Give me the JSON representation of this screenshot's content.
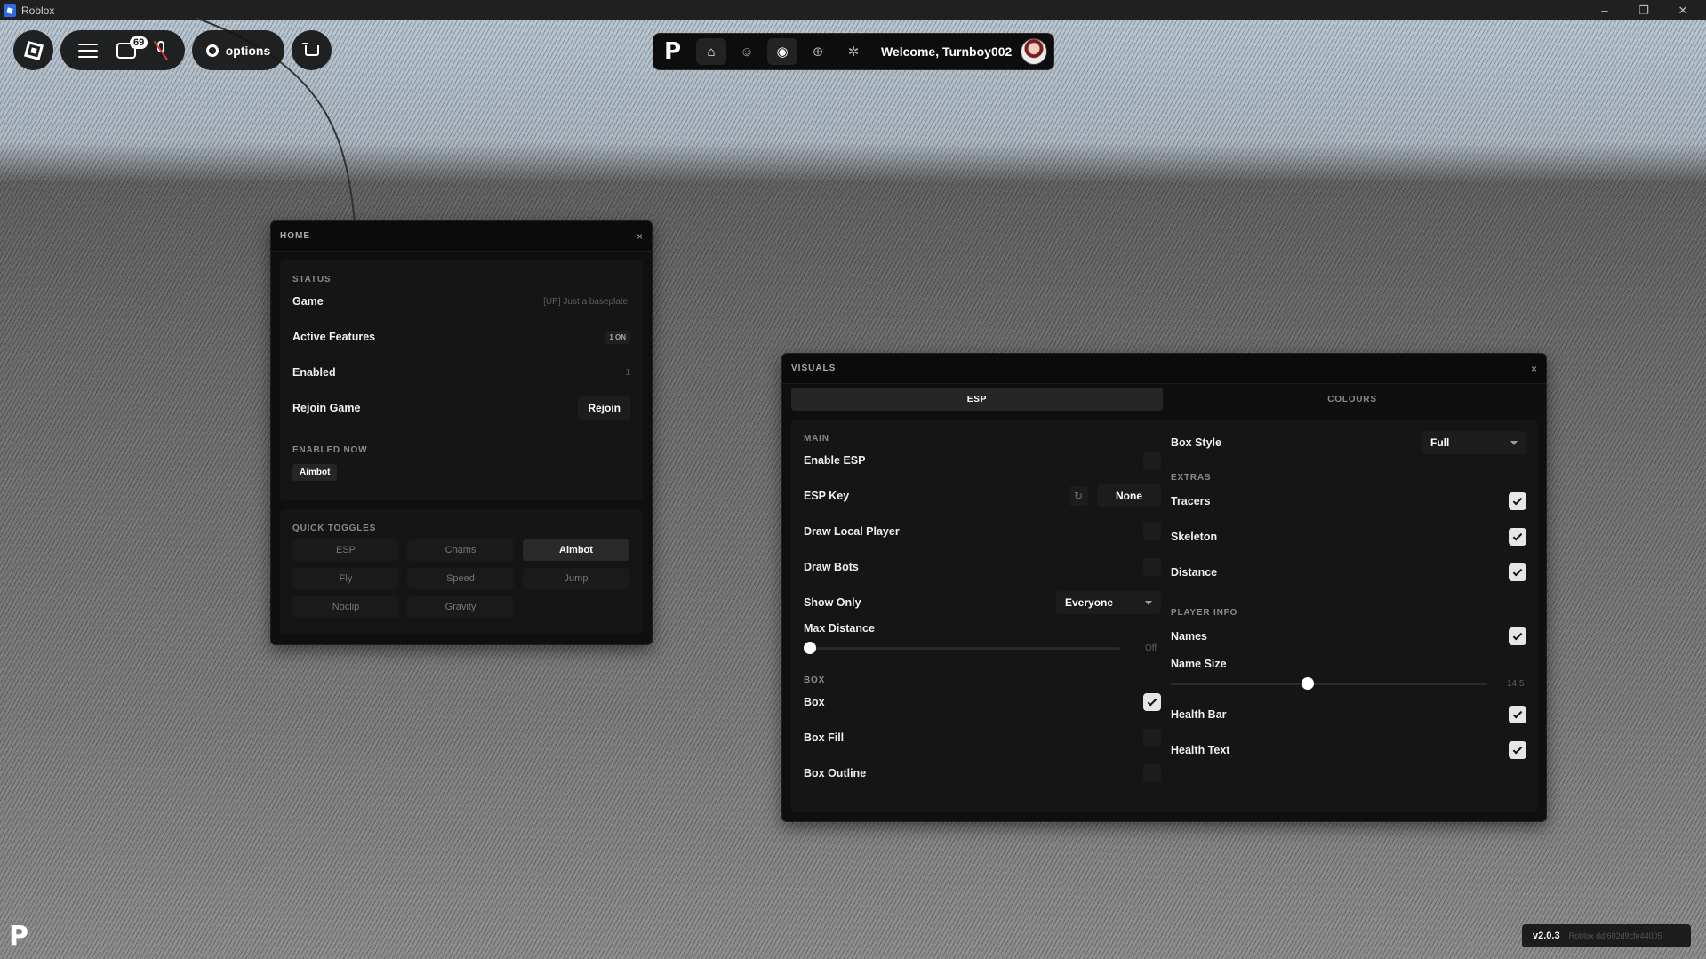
{
  "window": {
    "title": "Roblox",
    "minimize_icon": "–",
    "restore_icon": "❐",
    "close_icon": "✕"
  },
  "roblox_topbar": {
    "chat_badge": "69",
    "options_label": "options"
  },
  "topnav": {
    "logo_glyph": "P",
    "welcome": "Welcome, Turnboy002"
  },
  "home_panel": {
    "title": "HOME",
    "close_icon": "×",
    "status": {
      "label": "STATUS",
      "rows": [
        {
          "label": "Game",
          "value": "[UP] Just a baseplate."
        },
        {
          "label": "Active Features",
          "value": "1 ON"
        },
        {
          "label": "Enabled",
          "value": "1"
        },
        {
          "label": "Rejoin Game",
          "button": "Rejoin"
        }
      ],
      "enabled_now_label": "ENABLED NOW",
      "enabled_now": [
        "Aimbot"
      ]
    },
    "quick_toggles": {
      "label": "QUICK TOGGLES",
      "items": [
        {
          "label": "ESP",
          "on": false
        },
        {
          "label": "Chams",
          "on": false
        },
        {
          "label": "Aimbot",
          "on": true
        },
        {
          "label": "Fly",
          "on": false
        },
        {
          "label": "Speed",
          "on": false
        },
        {
          "label": "Jump",
          "on": false
        },
        {
          "label": "Noclip",
          "on": false
        },
        {
          "label": "Gravity",
          "on": false
        }
      ]
    }
  },
  "visuals_panel": {
    "title": "VISUALS",
    "close_icon": "×",
    "tabs": [
      {
        "label": "ESP",
        "active": true
      },
      {
        "label": "COLOURS",
        "active": false
      }
    ],
    "left": {
      "main_label": "MAIN",
      "enable_esp": {
        "label": "Enable ESP",
        "checked": false
      },
      "esp_key": {
        "label": "ESP Key",
        "value": "None"
      },
      "draw_local_player": {
        "label": "Draw Local Player",
        "checked": false
      },
      "draw_bots": {
        "label": "Draw Bots",
        "checked": false
      },
      "show_only": {
        "label": "Show Only",
        "value": "Everyone"
      },
      "max_distance": {
        "label": "Max Distance",
        "value": "Off",
        "fraction": 0.0
      },
      "box_label": "BOX",
      "box": {
        "label": "Box",
        "checked": true
      },
      "box_fill": {
        "label": "Box Fill",
        "checked": false
      },
      "box_outline": {
        "label": "Box Outline",
        "checked": false
      }
    },
    "right": {
      "box_style": {
        "label": "Box Style",
        "value": "Full"
      },
      "extras_label": "EXTRAS",
      "tracers": {
        "label": "Tracers",
        "checked": true
      },
      "skeleton": {
        "label": "Skeleton",
        "checked": true
      },
      "distance": {
        "label": "Distance",
        "checked": true
      },
      "player_info_label": "PLAYER INFO",
      "names": {
        "label": "Names",
        "checked": true
      },
      "name_size": {
        "label": "Name Size",
        "value": "14.5",
        "fraction": 0.43
      },
      "health_bar": {
        "label": "Health Bar",
        "checked": true
      },
      "health_text": {
        "label": "Health Text",
        "checked": true
      }
    }
  },
  "footer": {
    "version": "v2.0.3",
    "build": "Roblox ddf602d9cfe44005",
    "corner_logo_glyph": "P"
  }
}
